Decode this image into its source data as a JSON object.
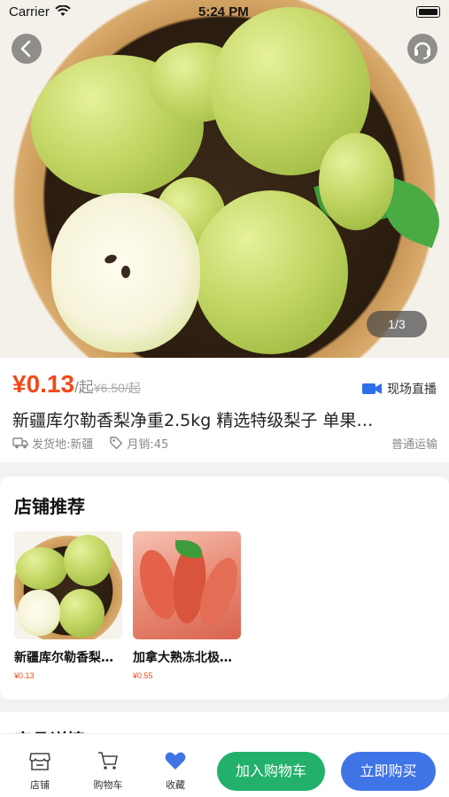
{
  "status_bar": {
    "carrier": "Carrier",
    "time": "5:24 PM"
  },
  "gallery": {
    "pager": "1/3"
  },
  "product": {
    "price": "¥0.13",
    "price_suffix": "/起",
    "original_price": "¥6.50/起",
    "live_label": "现场直播",
    "title": "新疆库尔勒香梨净重2.5kg 精选特级梨子 单果…",
    "origin": "发货地:新疆",
    "sales": "月销:45",
    "shipping": "普通运输"
  },
  "store_recommend": {
    "title": "店铺推荐",
    "items": [
      {
        "name": "新疆库尔勒香梨…",
        "price": "¥0.13"
      },
      {
        "name": "加拿大熟冻北极…",
        "price": "¥0.55"
      }
    ]
  },
  "next_section": {
    "title": "商品详情"
  },
  "bottom_bar": {
    "tabs": [
      {
        "label": "店铺",
        "icon": "store-icon"
      },
      {
        "label": "购物车",
        "icon": "cart-icon"
      },
      {
        "label": "收藏",
        "icon": "heart-icon"
      }
    ],
    "add_to_cart": "加入购物车",
    "buy_now": "立即购买"
  },
  "colors": {
    "price": "#f04a1a",
    "cart_button": "#22b06a",
    "buy_button": "#3f74e6",
    "favorite": "#3f74e6"
  }
}
